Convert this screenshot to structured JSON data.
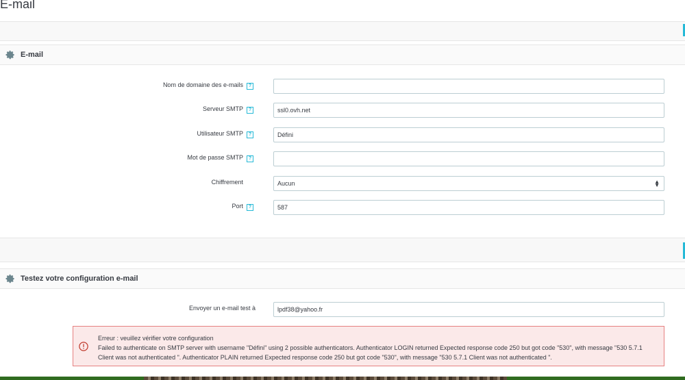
{
  "page": {
    "title": "E-mail"
  },
  "email_section": {
    "title": "E-mail",
    "fields": {
      "domain": {
        "label": "Nom de domaine des e-mails",
        "value": ""
      },
      "smtp_server": {
        "label": "Serveur SMTP",
        "value": "ssl0.ovh.net"
      },
      "smtp_user": {
        "label": "Utilisateur SMTP",
        "value": "Défini"
      },
      "smtp_password": {
        "label": "Mot de passe SMTP",
        "value": ""
      },
      "encryption": {
        "label": "Chiffrement",
        "value": "Aucun"
      },
      "port": {
        "label": "Port",
        "value": "587"
      }
    },
    "help_glyph": "?"
  },
  "test_section": {
    "title": "Testez votre configuration e-mail",
    "send_to": {
      "label": "Envoyer un e-mail test à",
      "value": "lpdf38@yahoo.fr"
    }
  },
  "alert": {
    "title": "Erreur : veuillez vérifier votre configuration",
    "message": "Failed to authenticate on SMTP server with username \"Défini\" using 2 possible authenticators. Authenticator LOGIN returned Expected response code 250 but got code \"530\", with message \"530 5.7.1 Client was not authenticated \". Authenticator PLAIN returned Expected response code 250 but got code \"530\", with message \"530 5.7.1 Client was not authenticated \"."
  },
  "icons": {
    "section": "gear-icon",
    "help": "help-icon",
    "error": "error-circle-icon",
    "select": "select-caret-icon"
  },
  "colors": {
    "accent": "#25b9d7",
    "error_border": "#e68080",
    "error_bg": "#fbe9e9",
    "text": "#363a41"
  }
}
